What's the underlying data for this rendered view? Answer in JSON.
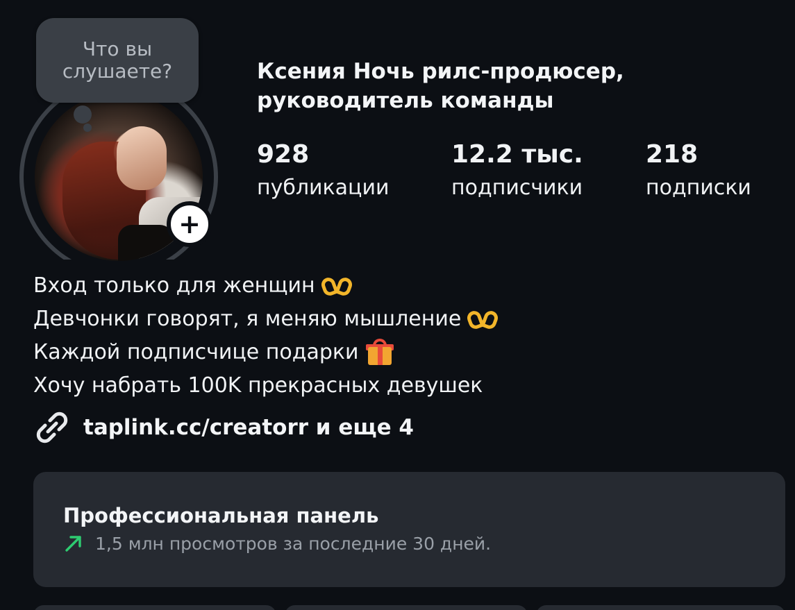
{
  "note": {
    "text_line1": "Что вы",
    "text_line2": "слушаете?"
  },
  "profile": {
    "name_line1": "Ксения Ночь рилс-продюсер,",
    "name_line2": "руководитель команды"
  },
  "stats": [
    {
      "value": "928",
      "label": "публикации"
    },
    {
      "value": "12.2 тыс.",
      "label": "подписчики"
    },
    {
      "value": "218",
      "label": "подписки"
    }
  ],
  "bio": {
    "line1": "Вход только для женщин",
    "line2": "Девчонки говорят, я меняю мышление",
    "line3": "Каждой подписчице подарки",
    "line4": "Хочу набрать 100K прекрасных девушек"
  },
  "link": {
    "text": "taplink.cc/creatorr и еще 4"
  },
  "pro_panel": {
    "title": "Профессиональная панель",
    "subtitle": "1,5 млн просмотров за последние 30 дней."
  },
  "icons": {
    "add": "plus-icon",
    "link": "link-icon",
    "trend": "trend-up-arrow-icon",
    "heart_hands": "heart-hands-emoji",
    "gift": "gift-emoji"
  },
  "colors": {
    "background": "#0c0f14",
    "panel": "#262a31",
    "trend_green": "#2ecc71",
    "note_bubble": "#3a3f46"
  }
}
